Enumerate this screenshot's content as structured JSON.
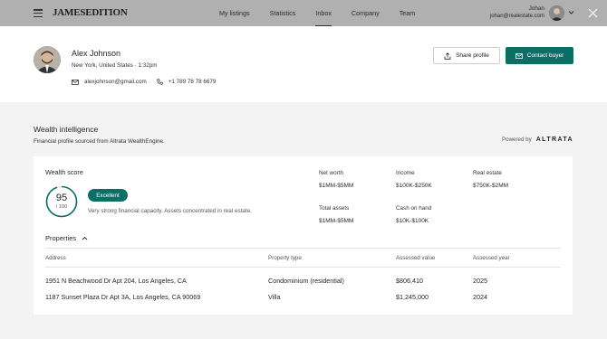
{
  "topbar": {
    "logo": "JAMESEDITION",
    "nav": [
      {
        "label": "My listings",
        "active": false
      },
      {
        "label": "Statistics",
        "active": false
      },
      {
        "label": "Inbox",
        "active": true
      },
      {
        "label": "Company",
        "active": false
      },
      {
        "label": "Team",
        "active": false
      }
    ],
    "user_name": "Johan",
    "user_email": "johan@realestate.com"
  },
  "profile": {
    "name": "Alex Johnson",
    "location": "New York, United States · 1:32pm",
    "email": "alexjohnson@gmail.com",
    "phone": "+1 789 78 78 6679",
    "share_label": "Share profile",
    "contact_label": "Contact buyer"
  },
  "wealth": {
    "title": "Wealth intelligence",
    "subtitle": "Financial profile sourced from Altrata WealthEngine.",
    "powered_label": "Powered by",
    "powered_brand": "ALTRATA",
    "score_label": "Wealth score",
    "score": "95",
    "score_max": "/ 100",
    "score_fraction": 0.95,
    "badge": "Excellent",
    "description": "Very strong financial capacity. Assets concentrated in real estate.",
    "stats": [
      {
        "label": "Net worth",
        "value": "$1MM-$5MM"
      },
      {
        "label": "Income",
        "value": "$100K-$250K"
      },
      {
        "label": "Real estate",
        "value": "$750K-$2MM"
      },
      {
        "label": "Total assets",
        "value": "$1MM-$5MM"
      },
      {
        "label": "Cash on hand",
        "value": "$10K-$100K"
      }
    ]
  },
  "properties": {
    "title": "Properties",
    "columns": [
      "Address",
      "Property type",
      "Assessed value",
      "Assessed year"
    ],
    "rows": [
      [
        "1951 N Beachwood Dr Apt 204, Los Angeles, CA",
        "Condominium (residential)",
        "$806,410",
        "2025"
      ],
      [
        "1187 Sunset Plaza Dr Apt 3A, Los Angeles, CA 90069",
        "Villa",
        "$1,245,000",
        "2024"
      ]
    ]
  },
  "colors": {
    "accent": "#0d6e66",
    "topbar_dim": "#b0b0b0",
    "page_bg": "#f3f3f3"
  }
}
